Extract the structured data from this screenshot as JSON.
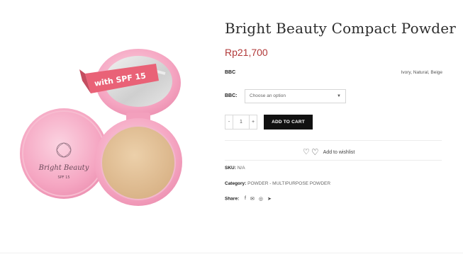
{
  "product": {
    "title": "Bright Beauty Compact Powder",
    "price": "Rp21,700",
    "image_texts": {
      "banner": "with SPF 15",
      "brand": "Bright Beauty",
      "spf": "SPF 15"
    }
  },
  "attributes": {
    "name": "BBC",
    "values": "Ivory, Natural, Beige"
  },
  "variation": {
    "label": "BBC:",
    "selected": "Choose an option"
  },
  "quantity": {
    "minus": "-",
    "value": "1",
    "plus": "+"
  },
  "cart": {
    "button_label": "ADD TO CART"
  },
  "wishlist": {
    "label": "Add to wishlist"
  },
  "meta": {
    "sku_label": "SKU:",
    "sku_value": "N/A",
    "category_label": "Category:",
    "category_value": "POWDER - MULTIPURPOSE POWDER",
    "share_label": "Share:"
  },
  "colors": {
    "price": "#b23a3a",
    "button": "#111111",
    "compact_pink": "#f5a9c4",
    "powder": "#e3c29a",
    "banner": "#e96277"
  },
  "icons": [
    "facebook-icon",
    "email-icon",
    "whatsapp-icon",
    "telegram-icon",
    "heart-icon",
    "chevron-down-icon"
  ]
}
